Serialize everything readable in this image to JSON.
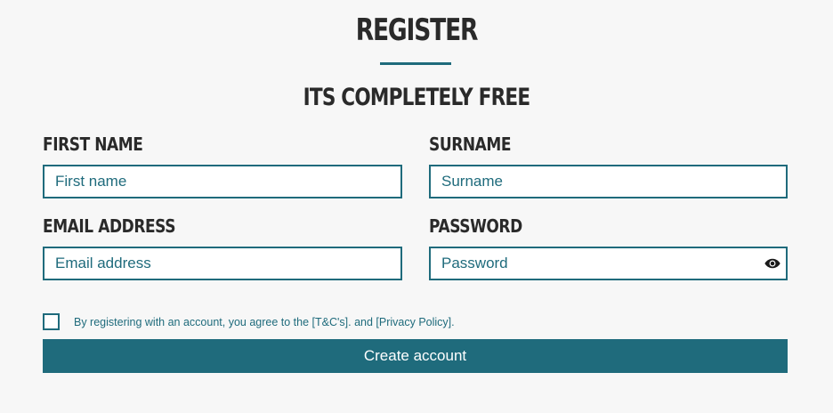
{
  "header": {
    "title": "REGISTER",
    "subtitle": "ITS COMPLETELY FREE"
  },
  "form": {
    "first_name": {
      "label": "FIRST NAME",
      "placeholder": "First name",
      "value": ""
    },
    "surname": {
      "label": "SURNAME",
      "placeholder": "Surname",
      "value": ""
    },
    "email": {
      "label": "EMAIL ADDRESS",
      "placeholder": "Email address",
      "value": ""
    },
    "password": {
      "label": "PASSWORD",
      "placeholder": "Password",
      "value": "",
      "toggle_icon": "eye-icon"
    },
    "terms": {
      "prefix": "By registering with an account, you agree to the ",
      "tc_link": "[T&C's]",
      "middle": ". and ",
      "privacy_link": "[Privacy Policy]",
      "suffix": ".",
      "checked": false
    },
    "submit_label": "Create account"
  },
  "colors": {
    "accent": "#1f6b7c",
    "background": "#f7f7f7",
    "heading": "#2a2a2a"
  }
}
